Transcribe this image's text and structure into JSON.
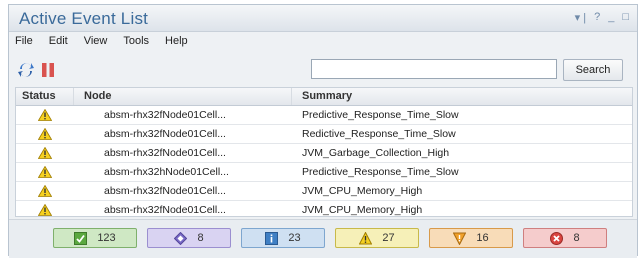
{
  "window": {
    "title": "Active Event List",
    "controls": {
      "pin": "▾ |",
      "help": "?",
      "minimize": "_",
      "maximize": "□"
    }
  },
  "menu": [
    "File",
    "Edit",
    "View",
    "Tools",
    "Help"
  ],
  "toolbar": {
    "refresh_icon": "refresh-icon",
    "pause_icon": "pause-icon",
    "search_value": "",
    "search_label": "Search"
  },
  "table": {
    "columns": [
      "Status",
      "Node",
      "Summary"
    ],
    "rows": [
      {
        "status": "warning",
        "node": "absm-rhx32fNode01Cell...",
        "summary": "Predictive_Response_Time_Slow"
      },
      {
        "status": "warning",
        "node": "absm-rhx32fNode01Cell...",
        "summary": "Redictive_Response_Time_Slow"
      },
      {
        "status": "warning",
        "node": "absm-rhx32fNode01Cell...",
        "summary": "JVM_Garbage_Collection_High"
      },
      {
        "status": "warning",
        "node": "absm-rhx32hNode01Cell...",
        "summary": "Predictive_Response_Time_Slow"
      },
      {
        "status": "warning",
        "node": "absm-rhx32fNode01Cell...",
        "summary": "JVM_CPU_Memory_High"
      },
      {
        "status": "warning",
        "node": "absm-rhx32fNode01Cell...",
        "summary": "JVM_CPU_Memory_High"
      }
    ]
  },
  "statusbar": [
    {
      "icon": "check-icon",
      "count": "123",
      "bg": "#cfe8c4",
      "border": "#7fb06c"
    },
    {
      "icon": "diamond-icon",
      "count": "8",
      "bg": "#d9d3f2",
      "border": "#9b8fd0"
    },
    {
      "icon": "info-icon",
      "count": "23",
      "bg": "#cfe0f2",
      "border": "#7ea6cf"
    },
    {
      "icon": "warning-icon",
      "count": "27",
      "bg": "#f6f0b8",
      "border": "#c8b94a"
    },
    {
      "icon": "minor-icon",
      "count": "16",
      "bg": "#f8dcb8",
      "border": "#d89a4a"
    },
    {
      "icon": "critical-icon",
      "count": "8",
      "bg": "#f5cccc",
      "border": "#cf7f7f"
    }
  ]
}
